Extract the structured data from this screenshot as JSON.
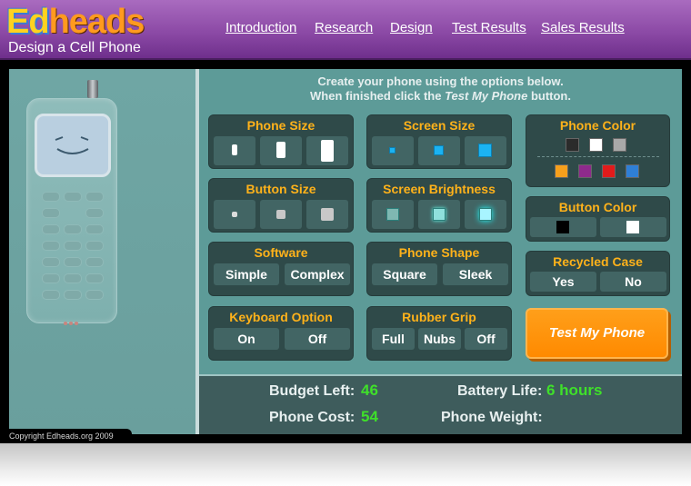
{
  "logo": {
    "part1": "Ed",
    "part2": "heads",
    "subtitle": "Design a Cell Phone"
  },
  "nav": [
    "Introduction",
    "Research",
    "Design",
    "Test Results",
    "Sales Results"
  ],
  "instructions": {
    "line1": "Create your phone using the options below.",
    "line2_prefix": "When finished click the ",
    "line2_emphasis": "Test My Phone",
    "line2_suffix": " button."
  },
  "groups": {
    "phone_size": {
      "title": "Phone Size"
    },
    "screen_size": {
      "title": "Screen Size"
    },
    "phone_color": {
      "title": "Phone Color",
      "row1": [
        "#2b2b2b",
        "#ffffff",
        "#a9a9a9"
      ],
      "row2": [
        "#f7a01c",
        "#8e2a8c",
        "#e21b1b",
        "#2f7fd6"
      ]
    },
    "button_size": {
      "title": "Button Size"
    },
    "screen_brightness": {
      "title": "Screen Brightness"
    },
    "button_color": {
      "title": "Button Color",
      "colors": [
        "#000000",
        "#ffffff"
      ]
    },
    "software": {
      "title": "Software",
      "options": [
        "Simple",
        "Complex"
      ]
    },
    "phone_shape": {
      "title": "Phone Shape",
      "options": [
        "Square",
        "Sleek"
      ]
    },
    "recycled_case": {
      "title": "Recycled Case",
      "options": [
        "Yes",
        "No"
      ]
    },
    "keyboard_option": {
      "title": "Keyboard Option",
      "options": [
        "On",
        "Off"
      ]
    },
    "rubber_grip": {
      "title": "Rubber Grip",
      "options": [
        "Full",
        "Nubs",
        "Off"
      ]
    }
  },
  "test_button": "Test My Phone",
  "stats": {
    "budget_label": "Budget Left:",
    "budget_value": "46",
    "cost_label": "Phone Cost:",
    "cost_value": "54",
    "battery_label": "Battery Life:",
    "battery_value": "6 hours",
    "weight_label": "Phone Weight:",
    "weight_value": ""
  },
  "copyright": "Copyright Edheads.org 2009",
  "colors": {
    "accent": "#ffb21a",
    "value_green": "#3fe02a",
    "header_purple": "#8c4aa6",
    "test_orange": "#ff8a00"
  }
}
